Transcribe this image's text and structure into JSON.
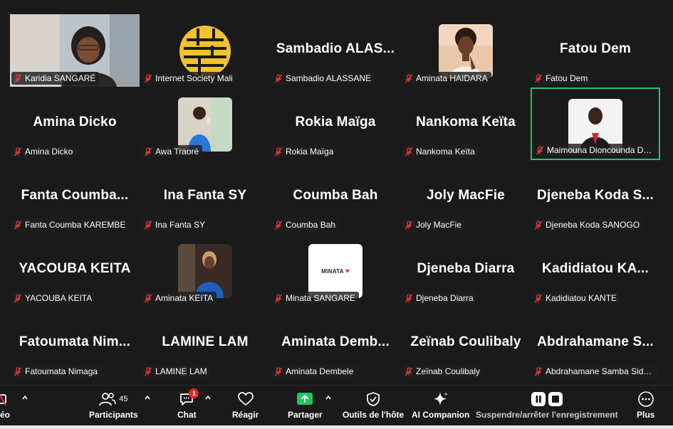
{
  "participants": [
    {
      "display": "video",
      "label": "Karidia SANGARÉ"
    },
    {
      "display": "logo",
      "label": "Internet Society Mali"
    },
    {
      "display": "name",
      "big": "Sambadio  ALAS...",
      "label": "Sambadio ALASSANE"
    },
    {
      "display": "photo",
      "photo": "woman-think",
      "label": "Aminata HAIDARA"
    },
    {
      "display": "name",
      "big": "Fatou Dem",
      "label": "Fatou Dem"
    },
    {
      "display": "name",
      "big": "Amina Dicko",
      "label": "Amina Dicko"
    },
    {
      "display": "photo",
      "photo": "woman-blue",
      "label": "Awa Traoré"
    },
    {
      "display": "name",
      "big": "Rokia Maïga",
      "label": "Rokia Maïga"
    },
    {
      "display": "name",
      "big": "Nankoma Keïta",
      "label": "Nankoma Keïta"
    },
    {
      "display": "photo",
      "photo": "woman-black",
      "label": "Maimouna Dioncounda DEMBELE",
      "speaking": true
    },
    {
      "display": "name",
      "big": "Fanta  Coumba...",
      "label": "Fanta Coumba KAREMBE"
    },
    {
      "display": "name",
      "big": "Ina Fanta SY",
      "label": "Ina Fanta SY"
    },
    {
      "display": "name",
      "big": "Coumba Bah",
      "label": "Coumba Bah"
    },
    {
      "display": "name",
      "big": "Joly MacFie",
      "label": "Joly MacFie"
    },
    {
      "display": "name",
      "big": "Djeneba  Koda  S...",
      "label": "Djeneba Koda SANOGO"
    },
    {
      "display": "name",
      "big": "YACOUBA KEITA",
      "label": "YACOUBA KEITA"
    },
    {
      "display": "photo",
      "photo": "woman-dark",
      "label": "Aminata KEITA"
    },
    {
      "display": "photo",
      "photo": "minata",
      "label": "Minata SANGARE",
      "avatar_text": "MINATA"
    },
    {
      "display": "name",
      "big": "Djeneba Diarra",
      "label": "Djeneba Diarra"
    },
    {
      "display": "name",
      "big": "Kadidiatou  KA...",
      "label": "Kadidiatou KANTE"
    },
    {
      "display": "name",
      "big": "Fatoumata  Nim...",
      "label": "Fatoumata Nimaga"
    },
    {
      "display": "name",
      "big": "LAMINE LAM",
      "label": "LAMINE LAM"
    },
    {
      "display": "name",
      "big": "Aminata  Demb...",
      "label": "Aminata Dembele"
    },
    {
      "display": "name",
      "big": "Zeïnab Coulibaly",
      "label": "Zeïnab Coulibaly"
    },
    {
      "display": "name",
      "big": "Abdrahamane  S...",
      "label": "Abdrahamane Samba Sidibé"
    }
  ],
  "toolbar": {
    "video_label": "éo",
    "participants_label": "Participants",
    "participants_count": "45",
    "chat_label": "Chat",
    "chat_badge": "1",
    "react_label": "Réagir",
    "share_label": "Partager",
    "host_tools_label": "Outils de l'hôte",
    "ai_label": "AI Companion",
    "record_label": "Suspendre/arrêter l'enregistrement",
    "more_label": "Plus"
  },
  "colors": {
    "background": "#1a1a1a",
    "speaking_border": "#2fbf71",
    "share_green": "#22c55e",
    "mute_red": "#e03a3a",
    "badge_red": "#e02828"
  }
}
